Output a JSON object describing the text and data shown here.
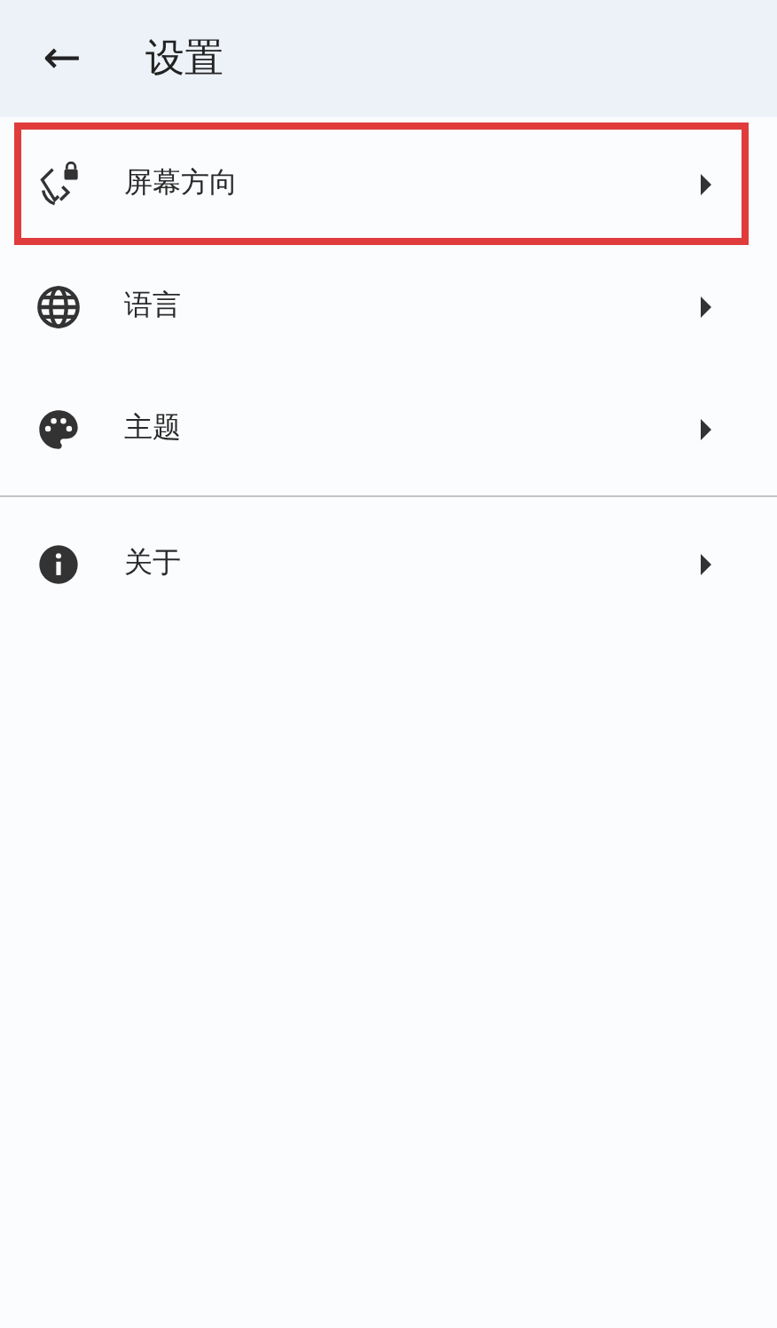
{
  "app_bar": {
    "back": "←",
    "title": "设置"
  },
  "sections": [
    {
      "items": [
        {
          "kind": "rotation",
          "label": "屏幕方向",
          "highlighted": true
        },
        {
          "kind": "language",
          "label": "语言",
          "highlighted": false
        },
        {
          "kind": "theme",
          "label": "主题",
          "highlighted": false
        }
      ]
    },
    {
      "items": [
        {
          "kind": "about",
          "label": "关于",
          "highlighted": false
        }
      ]
    }
  ]
}
